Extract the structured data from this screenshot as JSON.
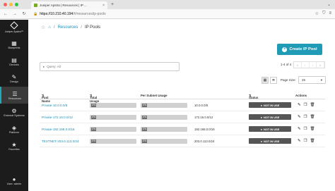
{
  "browser": {
    "tab_title": "Juniper Apstra | Resources | IP ...",
    "url_host": "https://10.210.40.194",
    "url_path": "/#/resources/ip-pools"
  },
  "sidebar": {
    "brand": "Juniper Apstra™",
    "items": [
      {
        "label": "Blueprints",
        "icon": "blueprint-icon"
      },
      {
        "label": "Devices",
        "icon": "devices-icon"
      },
      {
        "label": "Design",
        "icon": "design-icon"
      },
      {
        "label": "Resources",
        "icon": "resources-icon",
        "active": true
      },
      {
        "label": "External Systems",
        "icon": "external-systems-icon"
      },
      {
        "label": "Platform",
        "icon": "platform-icon"
      },
      {
        "label": "Favorites",
        "icon": "favorites-icon"
      }
    ],
    "user": "User: admin"
  },
  "breadcrumb": {
    "section": "Resources",
    "current": "IP Pools"
  },
  "create_button": "Create IP Pool",
  "query": "Query: All",
  "pager": {
    "range": "1-4 of 4"
  },
  "page_size": {
    "label": "Page Size:",
    "value": "25"
  },
  "table": {
    "headers": {
      "pool_name": "Pool Name",
      "total_usage": "Total Usage",
      "per_subnet": "Per Subnet Usage",
      "status": "Status",
      "actions": "Actions"
    },
    "rows": [
      {
        "name": "Private-10.0.0.0/8",
        "total": "0%",
        "per_subnet": "0%",
        "subnet": "10.0.0.0/8",
        "status": "NOT IN USE"
      },
      {
        "name": "Private-172.16.0.0/12",
        "total": "0%",
        "per_subnet": "0%",
        "subnet": "172.16.0.0/12",
        "status": "NOT IN USE"
      },
      {
        "name": "Private-192.168.0.0/16",
        "total": "0%",
        "per_subnet": "0%",
        "subnet": "192.168.0.0/16",
        "status": "NOT IN USE"
      },
      {
        "name": "TESTNET-203.0.113.0/24",
        "total": "0%",
        "per_subnet": "0%",
        "subnet": "203.0.113.0/24",
        "status": "NOT IN USE"
      }
    ]
  },
  "colors": {
    "accent": "#1f9bb5",
    "sidebar_bg": "#1c1c1c",
    "status_bg": "#555555"
  }
}
